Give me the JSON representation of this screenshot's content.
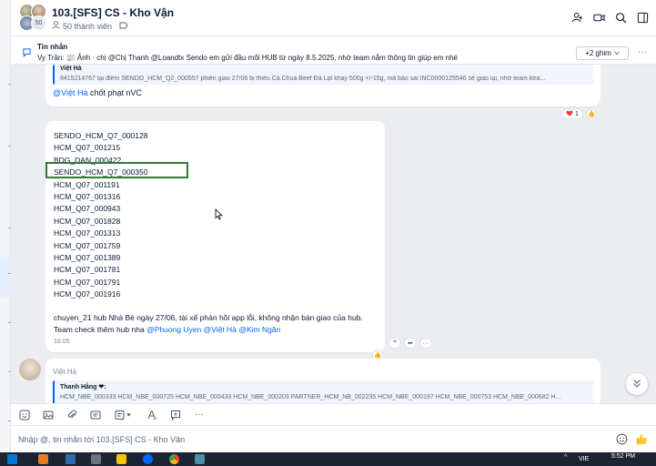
{
  "header": {
    "title": "103.[SFS] CS - Kho Vận",
    "member_count_badge": "50",
    "members": "50 thành viên",
    "icons": [
      "add-member-icon",
      "video-call-icon",
      "search-icon",
      "sidebar-toggle-icon"
    ]
  },
  "pinned": {
    "title": "Tin nhắn",
    "text": "Vy Trần: 📰 Ảnh · chị @Chị Thanh @Loandtx Sendo em gửi đầu mối HUB từ ngày 8.5.2025, nhờ team nắm thông tin giúp em nhé",
    "more_label": "+2 ghim"
  },
  "messages": {
    "m1": {
      "quote_author": "Việt Hà",
      "quote_text": "8415214767 tại điểm SENDO_HCM_Q2_000557 phiên giao 27/06 bị thiếu Cà Chua Beef Đà Lạt khay 500g +/-15g, mã báo sai INC0000125546 sẽ giao lại, nhờ team ktra...",
      "mention": "@Việt Hà",
      "body": " chốt phạt nVC",
      "reaction_count": "1"
    },
    "m2": {
      "codes": [
        "SENDO_HCM_Q7_000128",
        "HCM_Q07_001215",
        "BDG_DAN_000422",
        "SENDO_HCM_Q7_000350",
        "HCM_Q07_001191",
        "HCM_Q07_001316",
        "HCM_Q07_000943",
        "HCM_Q07_001828",
        "HCM_Q07_001313",
        "HCM_Q07_001759",
        "HCM_Q07_001389",
        "HCM_Q07_001781",
        "HCM_Q07_001791",
        "HCM_Q07_001916"
      ],
      "note_line1": "chuyen_21 hub Nhà Bè ngày 27/06, tài xế phản hồi app lỗi, không nhận bàn giao của hub.",
      "note_line2_prefix": "Team check thêm hub nha ",
      "mention1": "@Phuong Uyen",
      "mention2": "@Việt Hà",
      "mention3": "@Kim Ngân",
      "time": "16:05"
    },
    "m3": {
      "author": "Việt Hà",
      "quote_author": "Thanh Hằng ❤:",
      "quote_text": "HCM_NBE_000333 HCM_NBE_000725 HCM_NBE_000433 HCM_NBE_000203 PARTNER_HCM_NB_002235 HCM_NBE_000197 HCM_NBE_000753 HCM_NBE_000682 H..."
    }
  },
  "composer": {
    "placeholder": "Nhập @, tin nhắn tới 103.[SFS] CS - Kho Vận"
  },
  "taskbar": {
    "lang": "VIE",
    "time": "5:52 PM"
  },
  "colors": {
    "accent": "#0068ff",
    "highlight_border": "#2e7d32",
    "chat_bg": "#ebedf0"
  }
}
